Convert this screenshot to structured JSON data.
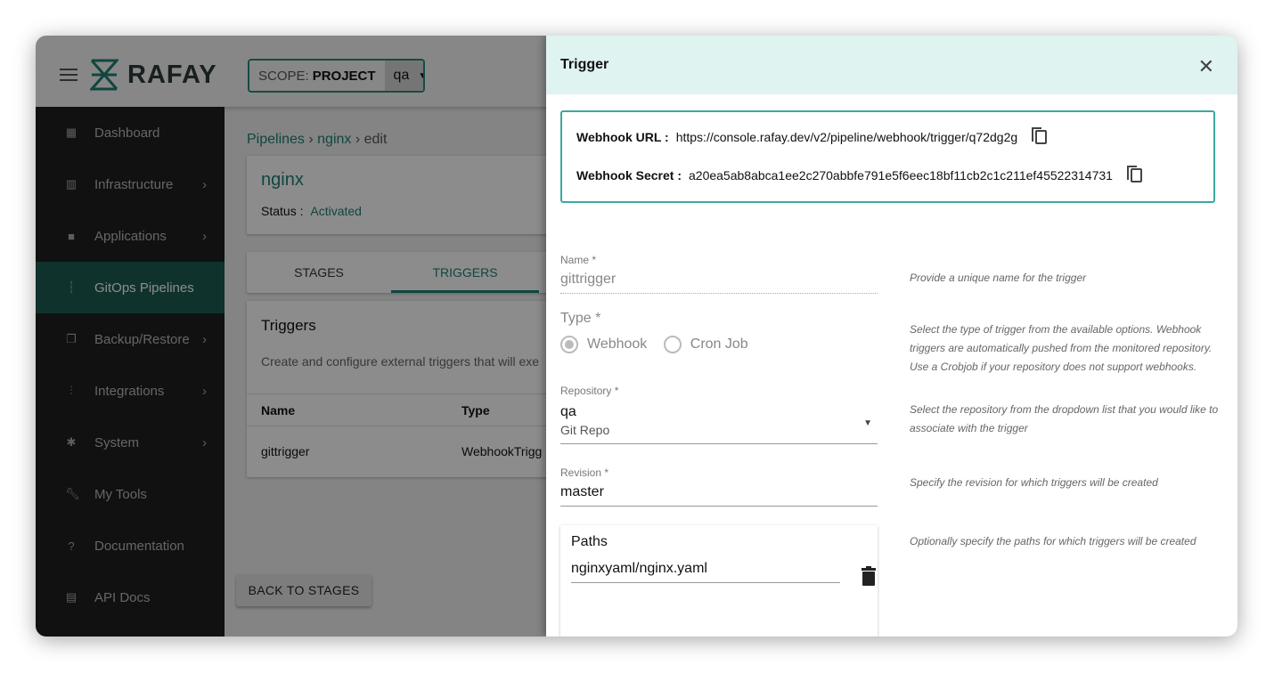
{
  "brand": "RAFAY",
  "scope": {
    "label": "SCOPE:",
    "value": "PROJECT",
    "project": "qa"
  },
  "sidebar": {
    "items": [
      {
        "label": "Dashboard",
        "icon": "dashboard-icon",
        "chevron": false
      },
      {
        "label": "Infrastructure",
        "icon": "building-icon",
        "chevron": true
      },
      {
        "label": "Applications",
        "icon": "briefcase-icon",
        "chevron": true
      },
      {
        "label": "GitOps Pipelines",
        "icon": "pipeline-icon",
        "chevron": false,
        "selected": true
      },
      {
        "label": "Backup/Restore",
        "icon": "copy-icon",
        "chevron": true
      },
      {
        "label": "Integrations",
        "icon": "sliders-icon",
        "chevron": true
      },
      {
        "label": "System",
        "icon": "gear-icon",
        "chevron": true
      },
      {
        "label": "My Tools",
        "icon": "wrench-icon",
        "chevron": false
      },
      {
        "label": "Documentation",
        "icon": "help-icon",
        "chevron": false
      },
      {
        "label": "API Docs",
        "icon": "clipboard-icon",
        "chevron": false
      }
    ]
  },
  "breadcrumb": [
    "Pipelines",
    "nginx",
    "edit"
  ],
  "pipeline": {
    "name": "nginx",
    "status_label": "Status :",
    "status": "Activated"
  },
  "tabs": [
    "STAGES",
    "TRIGGERS"
  ],
  "triggers": {
    "title": "Triggers",
    "desc": "Create and configure external triggers that will exe",
    "columns": [
      "Name",
      "Type"
    ],
    "rows": [
      [
        "gittrigger",
        "WebhookTrigg"
      ]
    ]
  },
  "back_button": "BACK TO STAGES",
  "drawer": {
    "title": "Trigger",
    "webhook_url_label": "Webhook URL :",
    "webhook_url": "https://console.rafay.dev/v2/pipeline/webhook/trigger/q72dg2g",
    "webhook_secret_label": "Webhook Secret :",
    "webhook_secret": "a20ea5ab8abca1ee2c270abbfe791e5f6eec18bf11cb2c1c211ef45522314731",
    "name_label": "Name *",
    "name_value": "gittrigger",
    "name_help": "Provide a unique name for the trigger",
    "type_label": "Type *",
    "type_options": [
      "Webhook",
      "Cron Job"
    ],
    "type_selected": "Webhook",
    "type_help": "Select the type of trigger from the available options. Webhook triggers are automatically pushed from the monitored repository. Use a Crobjob if your repository does not support webhooks.",
    "repo_label": "Repository *",
    "repo_value": "qa",
    "repo_sub": "Git Repo",
    "repo_help": "Select the repository from the dropdown list that you would like to associate with the trigger",
    "revision_label": "Revision *",
    "revision_value": "master",
    "revision_help": "Specify the revision for which triggers will be created",
    "paths_label": "Paths",
    "path_value": "nginxyaml/nginx.yaml",
    "paths_help": "Optionally specify the paths for which triggers will be created"
  },
  "colors": {
    "accent": "#1e8074",
    "drawer_header": "#dff3f1",
    "border": "#3ba99c"
  }
}
